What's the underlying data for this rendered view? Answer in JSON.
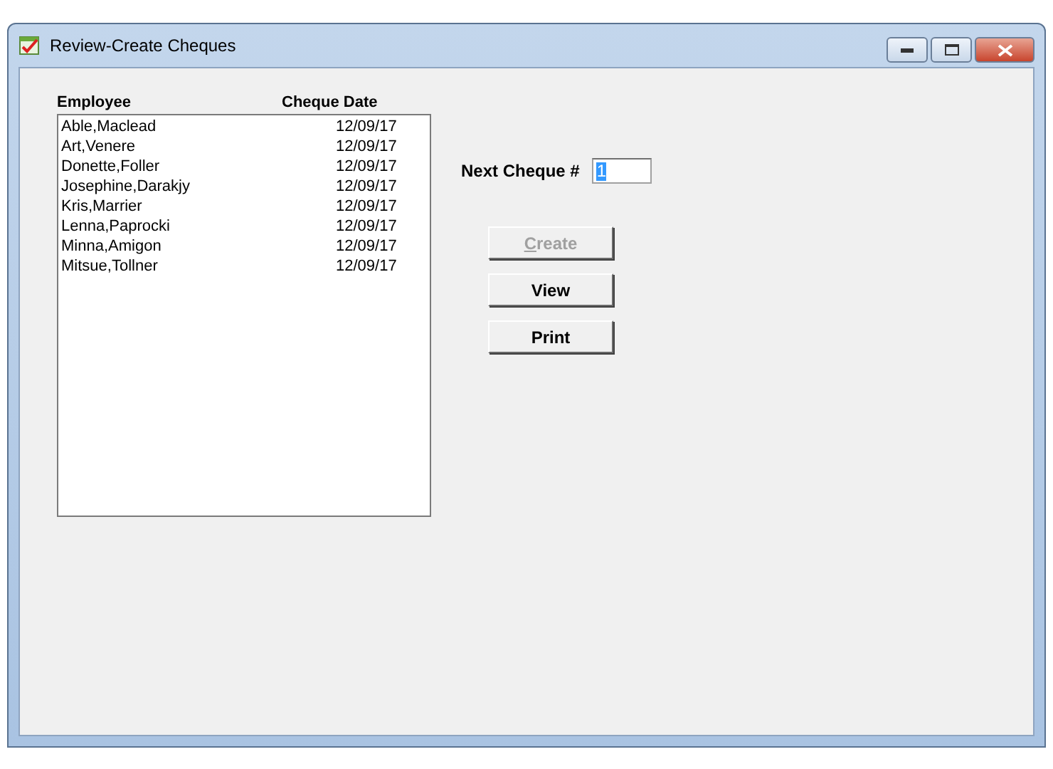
{
  "window": {
    "title": "Review-Create Cheques"
  },
  "list": {
    "columns": [
      "Employee",
      "Cheque Date"
    ],
    "rows": [
      {
        "employee": "Able,Maclead",
        "date": "12/09/17"
      },
      {
        "employee": "Art,Venere",
        "date": "12/09/17"
      },
      {
        "employee": "Donette,Foller",
        "date": "12/09/17"
      },
      {
        "employee": "Josephine,Darakjy",
        "date": "12/09/17"
      },
      {
        "employee": "Kris,Marrier",
        "date": "12/09/17"
      },
      {
        "employee": "Lenna,Paprocki",
        "date": "12/09/17"
      },
      {
        "employee": "Minna,Amigon",
        "date": "12/09/17"
      },
      {
        "employee": "Mitsue,Tollner",
        "date": "12/09/17"
      }
    ]
  },
  "next_cheque": {
    "label": "Next Cheque #",
    "value": "1"
  },
  "buttons": [
    {
      "label": "Create",
      "disabled": true,
      "mnemonic_underlined": true
    },
    {
      "label": "View",
      "disabled": false,
      "mnemonic_underlined": false
    },
    {
      "label": "Print",
      "disabled": false,
      "mnemonic_underlined": false
    }
  ]
}
